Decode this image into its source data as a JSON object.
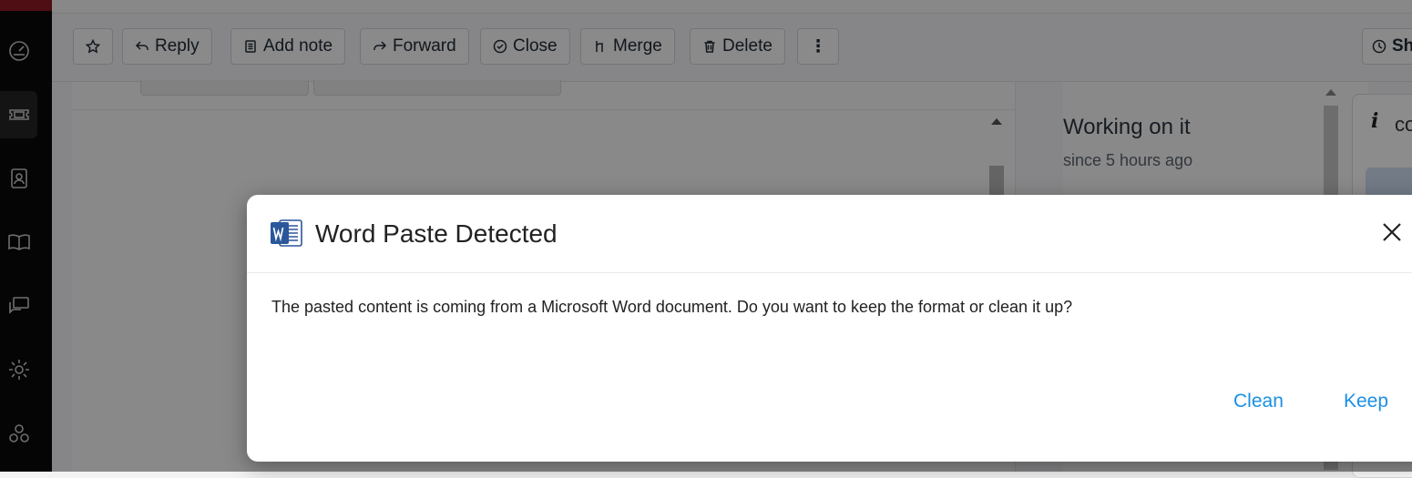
{
  "toolbar": {
    "star_label": "",
    "reply_label": "Reply",
    "add_note_label": "Add note",
    "forward_label": "Forward",
    "close_label": "Close",
    "merge_label": "Merge",
    "delete_label": "Delete",
    "more_label": "⋮",
    "show_label": "Sh"
  },
  "ticket_status": {
    "title": "Working on it",
    "since": "since 5 hours ago"
  },
  "info_panel": {
    "title_fragment": "co"
  },
  "dialog": {
    "title": "Word Paste Detected",
    "icon": "word-icon",
    "message": "The pasted content is coming from a Microsoft Word document. Do you want to keep the format or clean it up?",
    "clean_label": "Clean",
    "keep_label": "Keep",
    "link_color": "#1a8fe3"
  },
  "nav_icons": [
    "dashboard-icon",
    "tickets-icon",
    "contacts-icon",
    "knowledge-base-icon",
    "forums-icon",
    "settings-icon",
    "apps-icon"
  ],
  "colors": {
    "brand_accent": "#8f1a24",
    "rail": "#0a0a0a"
  }
}
